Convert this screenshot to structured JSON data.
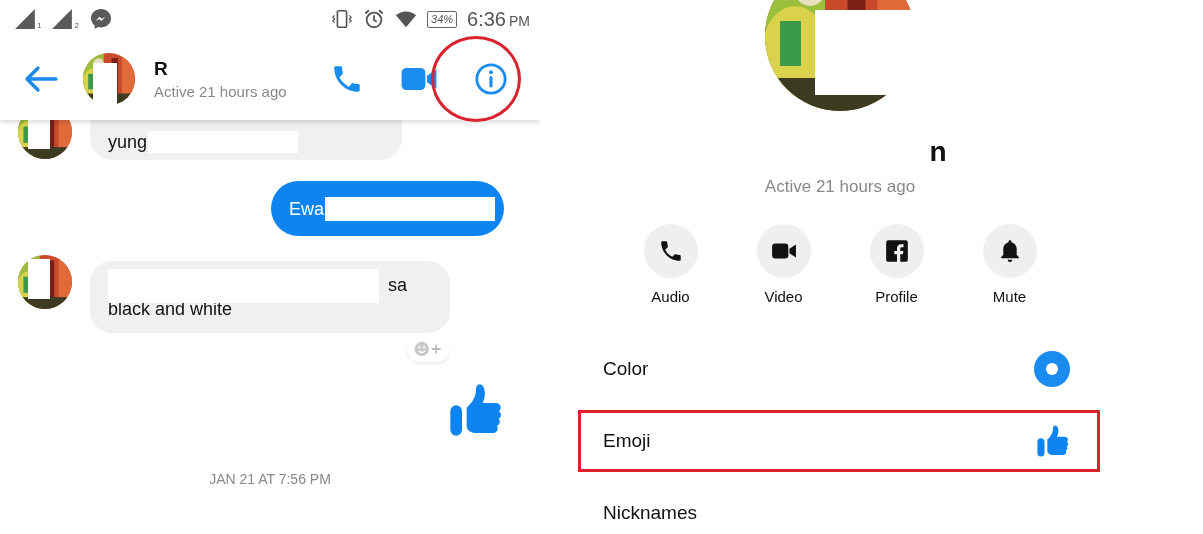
{
  "status_bar": {
    "sims": [
      "1",
      "2"
    ],
    "battery": "34%",
    "time": "6:36",
    "time_suffix": "PM"
  },
  "chat_header": {
    "name": "R",
    "subtitle": "Active 21 hours ago",
    "actions": [
      {
        "kind": "phone",
        "highlighted": false
      },
      {
        "kind": "video",
        "highlighted": false
      },
      {
        "kind": "info",
        "highlighted": true
      }
    ]
  },
  "messages": [
    {
      "kind": "incoming",
      "lines": [
        {
          "text": "yung",
          "kind": "redacted_end"
        }
      ]
    },
    {
      "kind": "outgoing",
      "lines": [
        {
          "text": "Ewa",
          "kind": "redacted_end"
        }
      ]
    },
    {
      "kind": "incoming",
      "lines": [
        {
          "text": "sa",
          "kind": "redacted_start"
        },
        {
          "text": "black and white",
          "kind": "plain"
        }
      ],
      "reaction_button": true
    },
    {
      "kind": "like"
    }
  ],
  "timestamp": "JAN 21 AT 7:56 PM",
  "profile": {
    "name": "n",
    "subtitle": "Active 21 hours ago"
  },
  "profile_actions": [
    {
      "kind": "phone",
      "label": "Audio"
    },
    {
      "kind": "video",
      "label": "Video"
    },
    {
      "kind": "facebook",
      "label": "Profile"
    },
    {
      "kind": "bell",
      "label": "Mute"
    }
  ],
  "settings": [
    {
      "kind": "color",
      "label": "Color",
      "color": "#1a8cf0",
      "highlighted": false
    },
    {
      "kind": "emoji",
      "label": "Emoji",
      "highlighted": true
    },
    {
      "kind": "plain",
      "label": "Nicknames",
      "highlighted": false
    }
  ]
}
